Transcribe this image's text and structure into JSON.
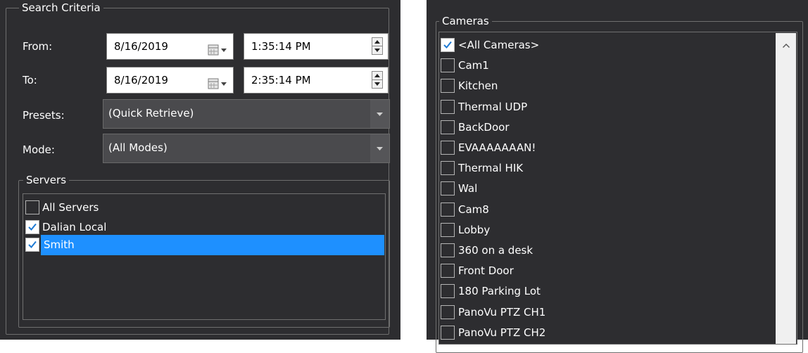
{
  "search": {
    "legend": "Search Criteria",
    "from_label": "From:",
    "from_date": "8/16/2019",
    "from_time": "1:35:14 PM",
    "to_label": "To:",
    "to_date": "8/16/2019",
    "to_time": "2:35:14 PM",
    "presets_label": "Presets:",
    "presets_value": "(Quick Retrieve)",
    "mode_label": "Mode:",
    "mode_value": "(All Modes)"
  },
  "servers": {
    "legend": "Servers",
    "items": [
      {
        "label": "All Servers",
        "checked": false,
        "selected": false
      },
      {
        "label": "Dalian Local",
        "checked": true,
        "selected": false
      },
      {
        "label": "Smith",
        "checked": true,
        "selected": true
      }
    ]
  },
  "cameras": {
    "legend": "Cameras",
    "items": [
      {
        "label": "<All Cameras>",
        "checked": true
      },
      {
        "label": "Cam1",
        "checked": false
      },
      {
        "label": "Kitchen",
        "checked": false
      },
      {
        "label": "Thermal UDP",
        "checked": false
      },
      {
        "label": "BackDoor",
        "checked": false
      },
      {
        "label": "EVAAAAAAAN!",
        "checked": false
      },
      {
        "label": "Thermal HIK",
        "checked": false
      },
      {
        "label": "Wal",
        "checked": false
      },
      {
        "label": "Cam8",
        "checked": false
      },
      {
        "label": "Lobby",
        "checked": false
      },
      {
        "label": "360 on a desk",
        "checked": false
      },
      {
        "label": "Front Door",
        "checked": false
      },
      {
        "label": "180 Parking Lot",
        "checked": false
      },
      {
        "label": "PanoVu PTZ CH1",
        "checked": false
      },
      {
        "label": "PanoVu PTZ CH2",
        "checked": false
      }
    ]
  },
  "colors": {
    "panel_bg": "#2d2d30",
    "selection": "#1e90ff",
    "check_blue": "#1e7ad4"
  },
  "icons": {
    "calendar": "calendar-dropdown-icon",
    "spinner": "up-down-spinner-icon",
    "combo": "chevron-down-icon",
    "scroll": "scroll-up-arrow-icon"
  }
}
